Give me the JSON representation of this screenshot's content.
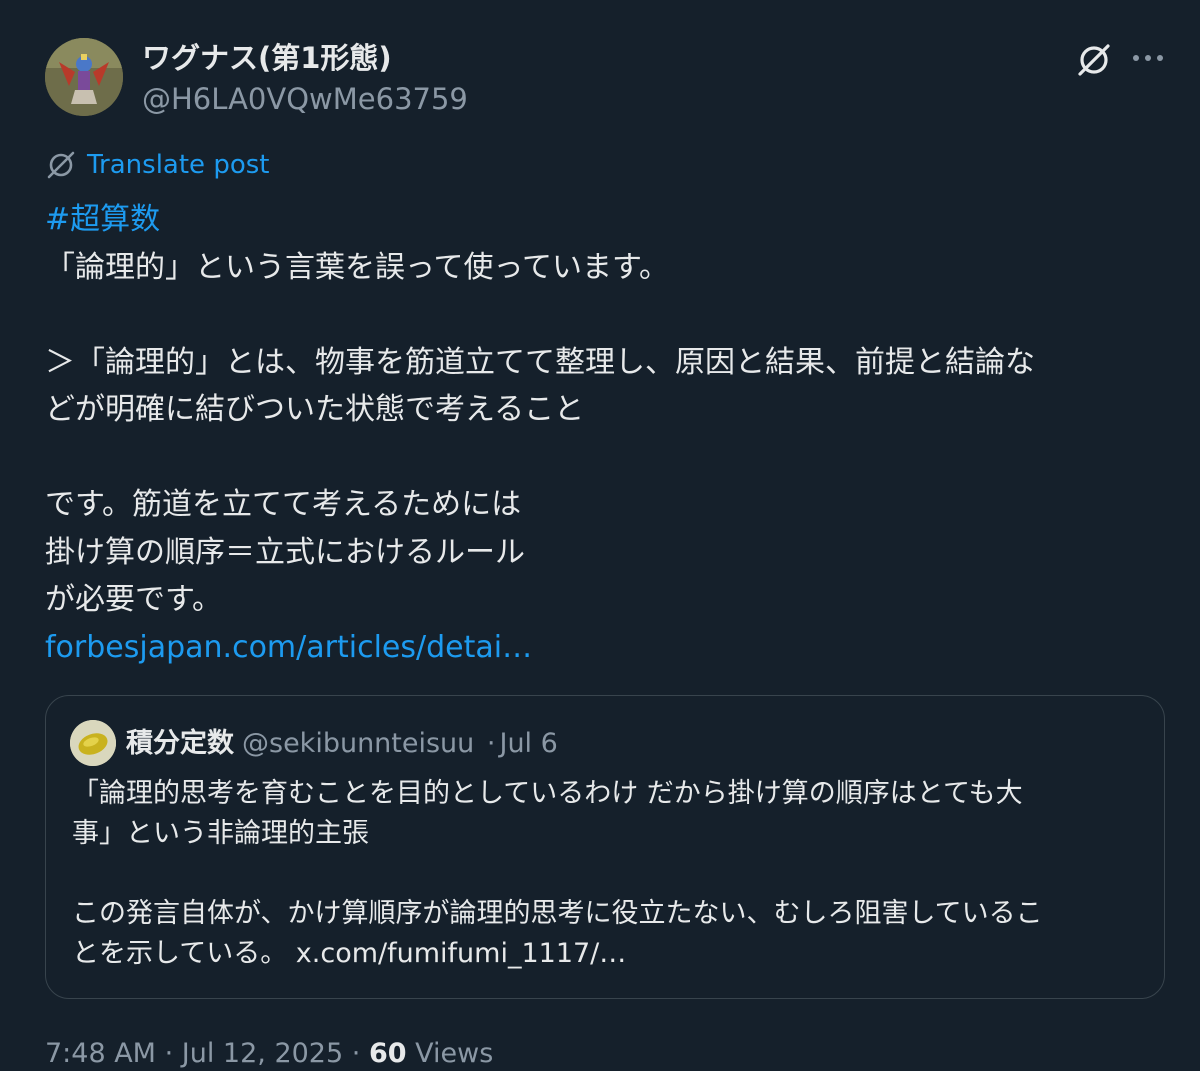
{
  "author": {
    "display_name": "ワグナス(第1形態)",
    "handle": "@H6LA0VQwMe63759",
    "avatar_icon": "user-avatar"
  },
  "header_actions": {
    "grok_icon": "grok-icon",
    "more_icon": "more-icon"
  },
  "translate": {
    "label": "Translate post",
    "icon": "translate-icon"
  },
  "post": {
    "hashtag": "#超算数",
    "lines": [
      "「論理的」という言葉を誤って使っています。",
      "",
      "＞「論理的」とは、物事を筋道立てて整理し、原因と結果、前提と結論な",
      "どが明確に結びついた状態で考えること",
      "",
      "です。筋道を立てて考えるためには",
      "掛け算の順序＝立式におけるルール",
      "が必要です。"
    ],
    "link": "forbesjapan.com/articles/detai…"
  },
  "quote": {
    "display_name": "積分定数",
    "handle": "@sekibunnteisuu",
    "separator": "·",
    "date": "Jul 6",
    "lines": [
      "「論理的思考を育むことを目的としているわけ だから掛け算の順序はとても大",
      "事」という非論理的主張",
      "",
      "この発言自体が、かけ算順序が論理的思考に役立たない、むしろ阻害しているこ"
    ],
    "last_line_text": "とを示している。",
    "last_line_link": "x.com/fumifumi_1117/…"
  },
  "meta": {
    "time": "7:48 AM",
    "separator": "·",
    "date": "Jul 12, 2025",
    "views_count": "60",
    "views_label": "Views"
  },
  "colors": {
    "background": "#15202b",
    "text": "#e7e9ea",
    "secondary": "#8b98a5",
    "accent": "#1d9bf0",
    "border": "#38444d"
  }
}
